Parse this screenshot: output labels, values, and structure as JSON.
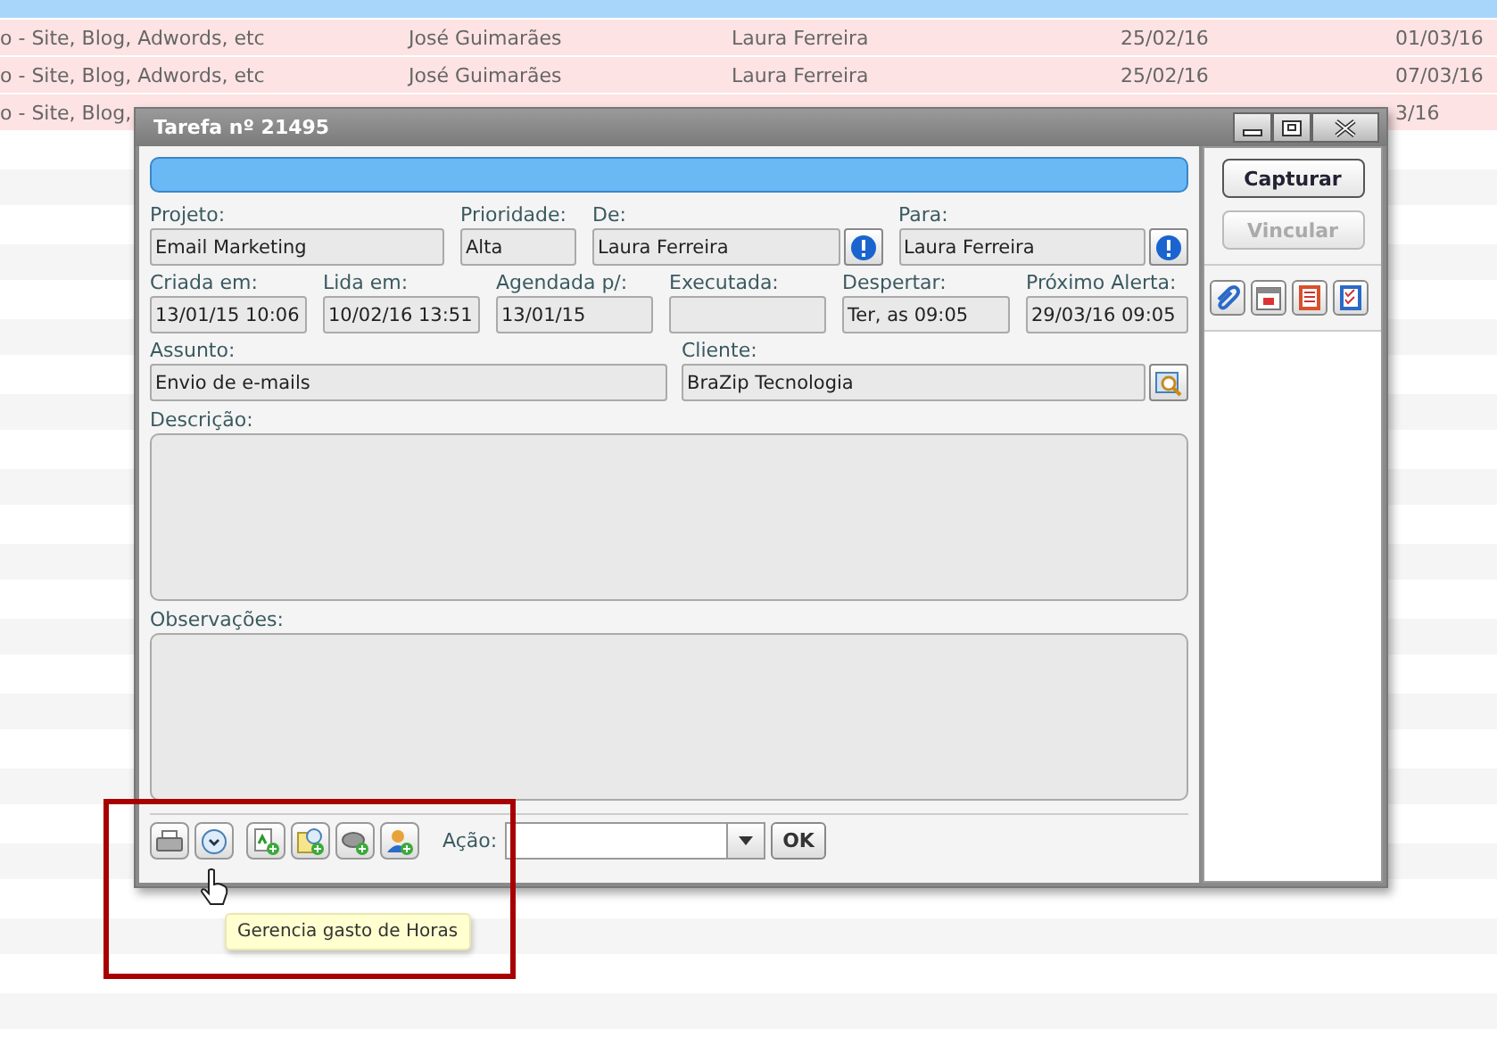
{
  "background_table": {
    "rows": [
      {
        "selected": true
      },
      {
        "selected": false,
        "column_1": "o - Site, Blog, Adwords, etc",
        "column_2": "José Guimarães",
        "column_3": "Laura Ferreira",
        "column_4": "25/02/16",
        "column_5": "01/03/16"
      },
      {
        "selected": false,
        "column_1": "o - Site, Blog, Adwords, etc",
        "column_2": "José Guimarães",
        "column_3": "Laura Ferreira",
        "column_4": "25/02/16",
        "column_5": "07/03/16"
      },
      {
        "selected": false,
        "column_1": "o - Site, Blog,",
        "column_5": "3/16"
      }
    ]
  },
  "window": {
    "title": "Tarefa nº 21495",
    "field_rows": [
      [
        {
          "kind": "text",
          "label": "Projeto:",
          "value": "Email Marketing"
        },
        {
          "kind": "text",
          "label": "Prioridade:",
          "value": "Alta"
        },
        {
          "kind": "alert",
          "label": "De:",
          "value": "Laura Ferreira"
        },
        {
          "kind": "alert",
          "label": "Para:",
          "value": "Laura Ferreira"
        }
      ],
      [
        {
          "kind": "text",
          "label": "Criada em:",
          "value": "13/01/15 10:06"
        },
        {
          "kind": "text",
          "label": "Lida em:",
          "value": "10/02/16 13:51"
        },
        {
          "kind": "text",
          "label": "Agendada p/:",
          "value": "13/01/15"
        },
        {
          "kind": "text",
          "label": "Executada:"
        },
        {
          "kind": "text",
          "label": "Despertar:",
          "value": "Ter, as 09:05"
        },
        {
          "kind": "text",
          "label": "Próximo Alerta:",
          "value": "29/03/16 09:05"
        }
      ],
      [
        {
          "kind": "text",
          "label": "Assunto:",
          "value": "Envio de e-mails"
        },
        {
          "kind": "search",
          "label": "Cliente:",
          "value": "BraZip Tecnologia"
        }
      ]
    ],
    "memos": [
      {
        "label": "Descrição:"
      },
      {
        "label": "Observações:"
      }
    ],
    "action": {
      "label": "Ação:",
      "button": "OK"
    },
    "side_buttons": [
      {
        "label": "Capturar",
        "disabled": false
      },
      {
        "label": "Vincular",
        "disabled": true
      }
    ]
  },
  "tooltip": "Gerencia gasto de Horas"
}
